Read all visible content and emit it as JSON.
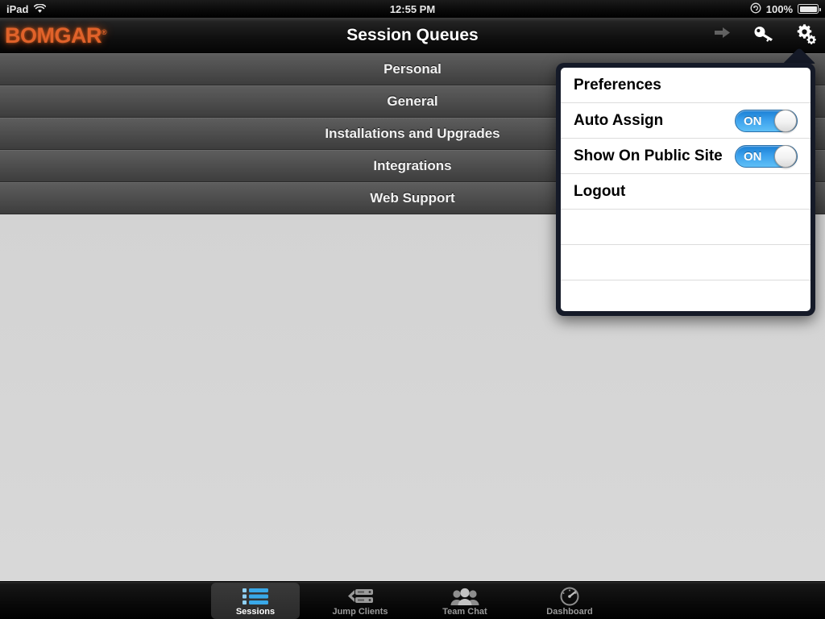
{
  "status_bar": {
    "device": "iPad",
    "wifi_icon": "wifi-icon",
    "time": "12:55 PM",
    "rotation_lock_icon": "rotation-lock-icon",
    "battery_percent": "100%",
    "battery_icon": "battery-icon"
  },
  "nav_bar": {
    "logo": "BOMGAR",
    "logo_trademark": "®",
    "title": "Session Queues",
    "actions": [
      {
        "name": "forward-arrow-icon",
        "label": "forward-arrow-icon",
        "enabled": false
      },
      {
        "name": "key-icon",
        "label": "key-icon",
        "enabled": true
      },
      {
        "name": "gear-icon",
        "label": "gear-icon",
        "enabled": true
      }
    ]
  },
  "queues": [
    {
      "label": "Personal"
    },
    {
      "label": "General"
    },
    {
      "label": "Installations and Upgrades"
    },
    {
      "label": "Integrations"
    },
    {
      "label": "Web Support"
    }
  ],
  "popover": {
    "title": "Preferences",
    "rows": [
      {
        "label": "Auto Assign",
        "toggle": "ON"
      },
      {
        "label": "Show On Public Site",
        "toggle": "ON"
      }
    ],
    "logout_label": "Logout",
    "empty_rows": 3
  },
  "tab_bar": {
    "tabs": [
      {
        "label": "Sessions",
        "icon": "list-icon",
        "active": true
      },
      {
        "label": "Jump Clients",
        "icon": "server-icon",
        "active": false
      },
      {
        "label": "Team Chat",
        "icon": "people-icon",
        "active": false
      },
      {
        "label": "Dashboard",
        "icon": "gauge-icon",
        "active": false
      }
    ]
  },
  "colors": {
    "brand_orange": "#e0622a",
    "toggle_blue": "#3ba0ec",
    "row_gray": "#4e4e4e",
    "content_bg": "#d6d6d6",
    "popover_border": "#151a28"
  }
}
